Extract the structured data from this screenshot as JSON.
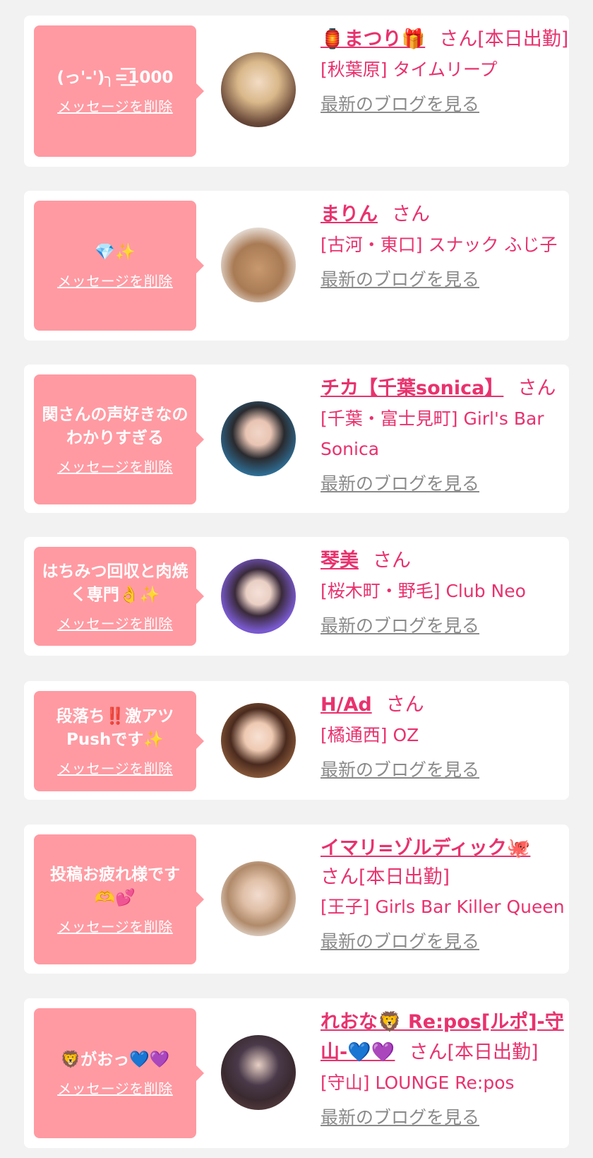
{
  "delete_label": "メッセージを削除",
  "blog_label": "最新のブログを見る",
  "san": "さん",
  "colors": {
    "accent": "#e8326e",
    "bubble": "#ff9aa2",
    "link_gray": "#8a8a8a",
    "background": "#f2f2f2"
  },
  "items": [
    {
      "message": "(っ'-')╮=͟͟͞͞1000",
      "name": "🏮まつり🎁",
      "san_suffix": "さん[本日出勤]",
      "shop": "[秋葉原] タイムリープ"
    },
    {
      "message": "💎✨",
      "name": "まりん",
      "san_suffix": "さん",
      "shop": "[古河・東口] スナック ふじ子"
    },
    {
      "message": "関さんの声好きなのわかりすぎる",
      "name": "チカ【千葉sonica】",
      "san_suffix": "さん",
      "shop": "[千葉・富士見町] Girl's Bar Sonica"
    },
    {
      "message": "はちみつ回収と肉焼く専門👌✨",
      "name": "琴美",
      "san_suffix": "さん",
      "shop": "[桜木町・野毛] Club Neo"
    },
    {
      "message": "段落ち‼️激アツPushです✨",
      "name": "H/Ad",
      "san_suffix": "さん",
      "shop": "[橘通西] OZ"
    },
    {
      "message": "投稿お疲れ様です🫶💕",
      "name": "イマリ=ゾルディック🐙",
      "san_suffix": "さん[本日出勤]",
      "shop": "[王子] Girls Bar Killer Queen"
    },
    {
      "message": "🦁がおっ💙💜",
      "name": "れおな🦁 Re:pos[ルポ]-守山-💙💜",
      "san_suffix": "さん[本日出勤]",
      "shop": "[守山] LOUNGE Re:pos"
    }
  ]
}
